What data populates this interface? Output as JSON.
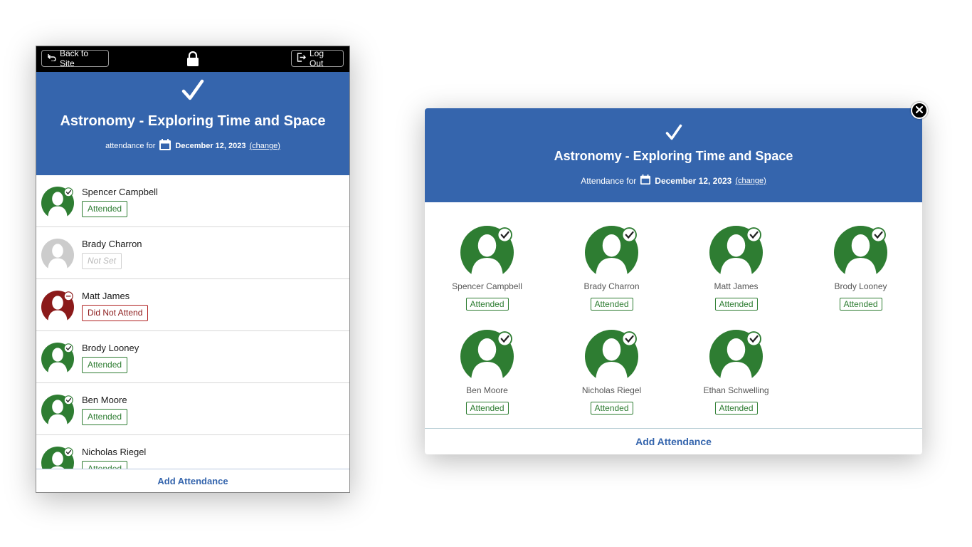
{
  "phone": {
    "back_label": "Back to Site",
    "logout_label": "Log Out",
    "title": "Astronomy - Exploring Time and Space",
    "attendance_for": "attendance for",
    "date": "December 12, 2023",
    "change_label": "(change)",
    "add_attendance": "Add Attendance",
    "people": [
      {
        "name": "Spencer Campbell",
        "status": "Attended"
      },
      {
        "name": "Brady Charron",
        "status": "Not Set"
      },
      {
        "name": "Matt James",
        "status": "Did Not Attend"
      },
      {
        "name": "Brody Looney",
        "status": "Attended"
      },
      {
        "name": "Ben Moore",
        "status": "Attended"
      },
      {
        "name": "Nicholas Riegel",
        "status": "Attended"
      }
    ]
  },
  "modal": {
    "title": "Astronomy - Exploring Time and Space",
    "attendance_for": "Attendance for",
    "date": "December 12, 2023",
    "change_label": "(change)",
    "add_attendance": "Add Attendance",
    "people": [
      {
        "name": "Spencer Campbell",
        "status": "Attended"
      },
      {
        "name": "Brady Charron",
        "status": "Attended"
      },
      {
        "name": "Matt James",
        "status": "Attended"
      },
      {
        "name": "Brody Looney",
        "status": "Attended"
      },
      {
        "name": "Ben Moore",
        "status": "Attended"
      },
      {
        "name": "Nicholas Riegel",
        "status": "Attended"
      },
      {
        "name": "Ethan Schwelling",
        "status": "Attended"
      }
    ]
  },
  "colors": {
    "header_blue": "#3565ad",
    "attended_green": "#2e7d32",
    "did_not_attend_red": "#8b1a1a",
    "not_set_gray": "#cccccc"
  },
  "icons": [
    "back-arrow-icon",
    "lock-icon",
    "logout-icon",
    "checkmark-icon",
    "calendar-icon",
    "avatar-icon",
    "status-check-icon",
    "status-minus-icon",
    "close-icon"
  ]
}
